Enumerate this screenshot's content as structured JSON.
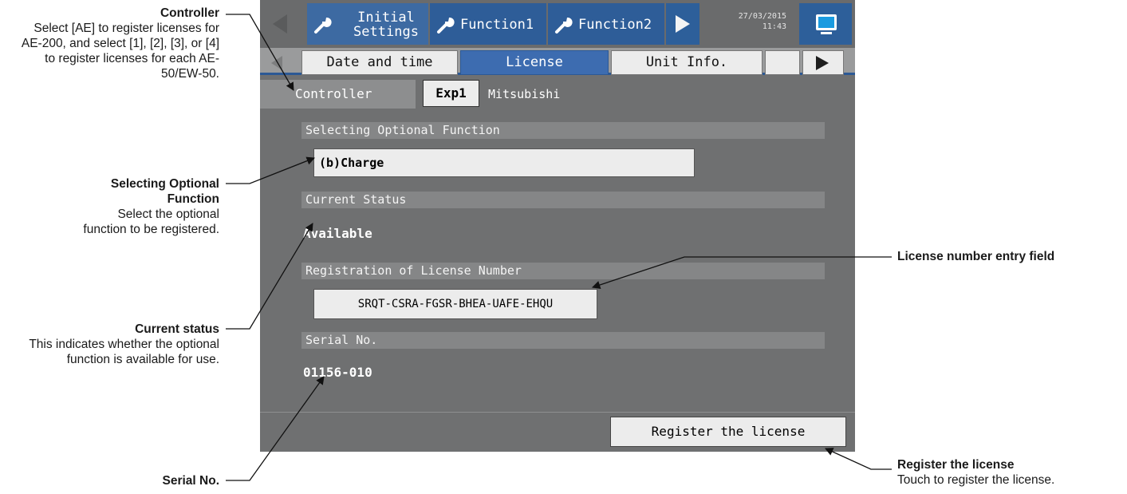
{
  "header": {
    "prev_label": "",
    "tabs": [
      {
        "label": "Initial Settings",
        "icon": "wrench-icon"
      },
      {
        "label": "Function1",
        "icon": "wrench-icon"
      },
      {
        "label": "Function2",
        "icon": "wrench-icon"
      }
    ],
    "datetime": {
      "date": "27/03/2015",
      "time": "11:43"
    },
    "monitor_icon": "monitor-icon"
  },
  "subtabs": [
    {
      "label": "Date and time",
      "active": false
    },
    {
      "label": "License",
      "active": true
    },
    {
      "label": "Unit Info.",
      "active": false
    },
    {
      "label": "",
      "active": false
    }
  ],
  "controller": {
    "label": "Controller",
    "button": "Exp1",
    "name": "Mitsubishi"
  },
  "optional_function": {
    "section": "Selecting Optional Function",
    "selected": "(b)Charge"
  },
  "status": {
    "section": "Current Status",
    "value": "Available"
  },
  "license": {
    "section": "Registration of License Number",
    "number": "SRQT-CSRA-FGSR-BHEA-UAFE-EHQU"
  },
  "serial": {
    "section": "Serial No.",
    "value": "01156-010"
  },
  "register_button": "Register the license",
  "annotations": {
    "controller": {
      "title": "Controller",
      "body": "Select [AE] to register licenses for AE-200, and select [1], [2], [3], or [4] to register licenses for each AE-50/EW-50."
    },
    "optional": {
      "title": "Selecting Optional Function",
      "body": "Select the optional function to be registered."
    },
    "status": {
      "title": "Current status",
      "body": "This indicates whether the optional function is available for use."
    },
    "serial": {
      "title": "Serial No."
    },
    "license_field": {
      "title": "License number entry field"
    },
    "register": {
      "title": "Register the license",
      "body": "Touch to register the license."
    }
  }
}
